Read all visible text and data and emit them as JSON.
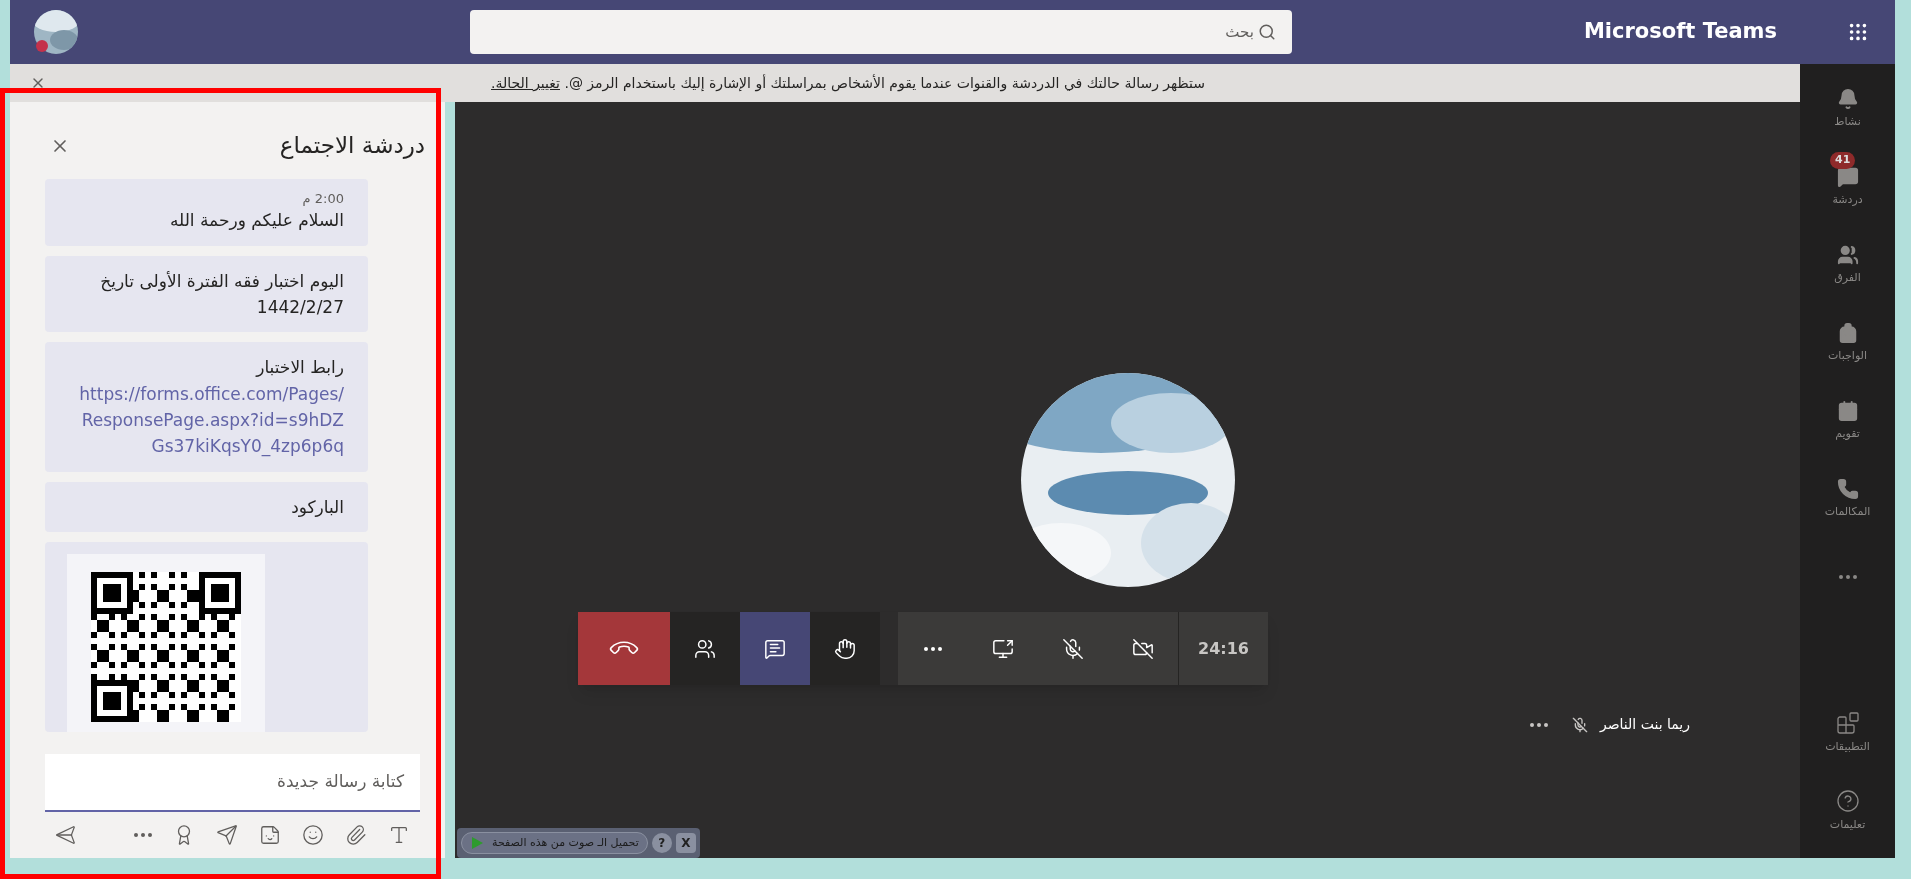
{
  "top_bar": {
    "app_title": "Microsoft Teams",
    "search": {
      "placeholder": "بحث"
    }
  },
  "notice": {
    "text": "ستظهر رسالة حالتك في الدردشة والقنوات عندما يقوم الأشخاص بمراسلتك أو الإشارة إليك باستخدام الرمز @.",
    "link": "تغيير الحالة."
  },
  "chat_panel": {
    "title": "دردشة الاجتماع",
    "messages": [
      {
        "kind": "text",
        "time": "2:00 م",
        "text": "السلام عليكم ورحمة الله"
      },
      {
        "kind": "text",
        "text": "اليوم اختبار فقه الفترة الأولى تاريخ 1442/2/27"
      },
      {
        "kind": "link",
        "text": "رابط الاختبار",
        "link": "https://forms.office.com/Pages/ResponsePage.aspx?id=s9hDZGs37kiKqsY0_4zp6p6q"
      },
      {
        "kind": "text",
        "text": "الباركود"
      },
      {
        "kind": "picture"
      }
    ],
    "compose": {
      "placeholder": "كتابة رسالة جديدة"
    },
    "tools": [
      {
        "kind": "format"
      },
      {
        "kind": "attach"
      },
      {
        "kind": "emoji"
      },
      {
        "kind": "sticker"
      },
      {
        "kind": "meet"
      },
      {
        "kind": "praise"
      },
      {
        "kind": "more"
      },
      {
        "kind": "send"
      }
    ]
  },
  "call": {
    "controls": [
      {
        "kind": "hangup",
        "selected": false
      },
      {
        "kind": "participants",
        "selected": false
      },
      {
        "kind": "chat",
        "selected": true
      },
      {
        "kind": "hand",
        "selected": false
      },
      {
        "kind": "more",
        "selected": false
      },
      {
        "kind": "share",
        "selected": false
      },
      {
        "kind": "mic_off",
        "selected": false
      },
      {
        "kind": "camera_off",
        "selected": false
      }
    ],
    "timer": "24:16",
    "participant": {
      "name": "ريما بنت الناصر",
      "muted": true
    }
  },
  "rail": {
    "items": [
      {
        "kind": "activity",
        "label": "نشاط"
      },
      {
        "kind": "chat",
        "label": "دردشة",
        "badge": "41"
      },
      {
        "kind": "teams",
        "label": "الفرق"
      },
      {
        "kind": "assignments",
        "label": "الواجبات"
      },
      {
        "kind": "calendar",
        "label": "تقويم"
      },
      {
        "kind": "calls",
        "label": "المكالمات"
      },
      {
        "kind": "more"
      }
    ],
    "bottom_items": [
      {
        "kind": "apps",
        "label": "التطبيقات"
      },
      {
        "kind": "help",
        "label": "تعليمات"
      }
    ]
  },
  "plugin_bar": {
    "text": "تحميل الـ صوت من هذه الصفحة",
    "help": "?",
    "close": "X"
  }
}
